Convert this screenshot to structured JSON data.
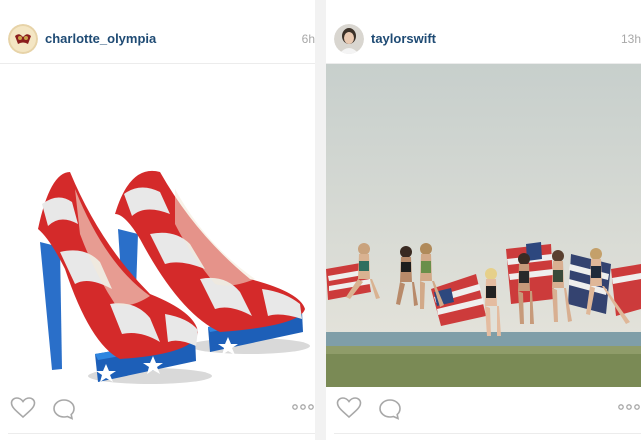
{
  "posts": [
    {
      "username": "charlotte_olympia",
      "timestamp": "6h",
      "photo_subject": "red-white-blue-striped-platform-heels"
    },
    {
      "username": "taylorswift",
      "timestamp": "13h",
      "photo_subject": "group-jumping-on-beach-with-flags"
    }
  ],
  "icons": {
    "like": "heart-icon",
    "comment": "comment-bubble-icon",
    "more": "more-options-icon"
  },
  "colors": {
    "username": "#1f4b74",
    "timestamp": "#a8a8a8",
    "icon": "#a8a8a8"
  }
}
